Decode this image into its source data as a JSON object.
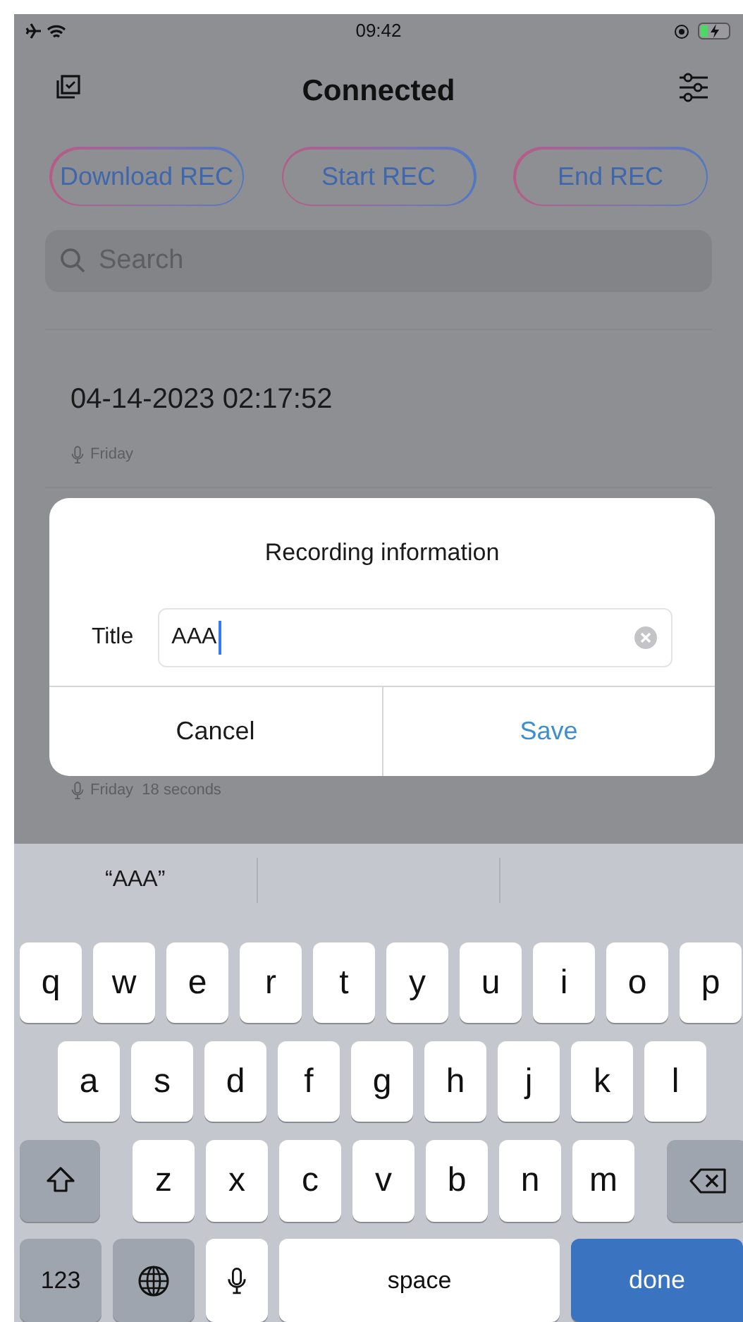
{
  "status_bar": {
    "time": "09:42"
  },
  "nav": {
    "title": "Connected"
  },
  "actions": [
    {
      "label": "Download REC"
    },
    {
      "label": "Start REC"
    },
    {
      "label": "End REC"
    }
  ],
  "search": {
    "placeholder": "Search"
  },
  "recordings": [
    {
      "title": "04-14-2023 02:17:52",
      "meta": "Friday"
    },
    {
      "meta": "Friday  18 seconds"
    }
  ],
  "dialog": {
    "title": "Recording information",
    "field_label": "Title",
    "value": "AAA",
    "buttons": [
      {
        "label": "Cancel",
        "kind": "cancel"
      },
      {
        "label": "Save",
        "kind": "save"
      }
    ]
  },
  "keyboard": {
    "suggestions": [
      "“AAA”"
    ],
    "rows": [
      {
        "keys": [
          {
            "kind": "letter",
            "label": "q"
          },
          {
            "kind": "letter",
            "label": "w"
          },
          {
            "kind": "letter",
            "label": "e"
          },
          {
            "kind": "letter",
            "label": "r"
          },
          {
            "kind": "letter",
            "label": "t"
          },
          {
            "kind": "letter",
            "label": "y"
          },
          {
            "kind": "letter",
            "label": "u"
          },
          {
            "kind": "letter",
            "label": "i"
          },
          {
            "kind": "letter",
            "label": "o"
          },
          {
            "kind": "letter",
            "label": "p"
          }
        ]
      },
      {
        "keys": [
          {
            "kind": "letter",
            "label": "a"
          },
          {
            "kind": "letter",
            "label": "s"
          },
          {
            "kind": "letter",
            "label": "d"
          },
          {
            "kind": "letter",
            "label": "f"
          },
          {
            "kind": "letter",
            "label": "g"
          },
          {
            "kind": "letter",
            "label": "h"
          },
          {
            "kind": "letter",
            "label": "j"
          },
          {
            "kind": "letter",
            "label": "k"
          },
          {
            "kind": "letter",
            "label": "l"
          }
        ]
      },
      {
        "keys": [
          {
            "kind": "shift"
          },
          {
            "kind": "letter",
            "label": "z"
          },
          {
            "kind": "letter",
            "label": "x"
          },
          {
            "kind": "letter",
            "label": "c"
          },
          {
            "kind": "letter",
            "label": "v"
          },
          {
            "kind": "letter",
            "label": "b"
          },
          {
            "kind": "letter",
            "label": "n"
          },
          {
            "kind": "letter",
            "label": "m"
          },
          {
            "kind": "delete"
          }
        ]
      },
      {
        "keys": [
          {
            "kind": "numbers",
            "label": "123"
          },
          {
            "kind": "globe"
          },
          {
            "kind": "mic"
          },
          {
            "kind": "space",
            "label": "space"
          },
          {
            "kind": "done",
            "label": "done"
          }
        ]
      }
    ]
  }
}
